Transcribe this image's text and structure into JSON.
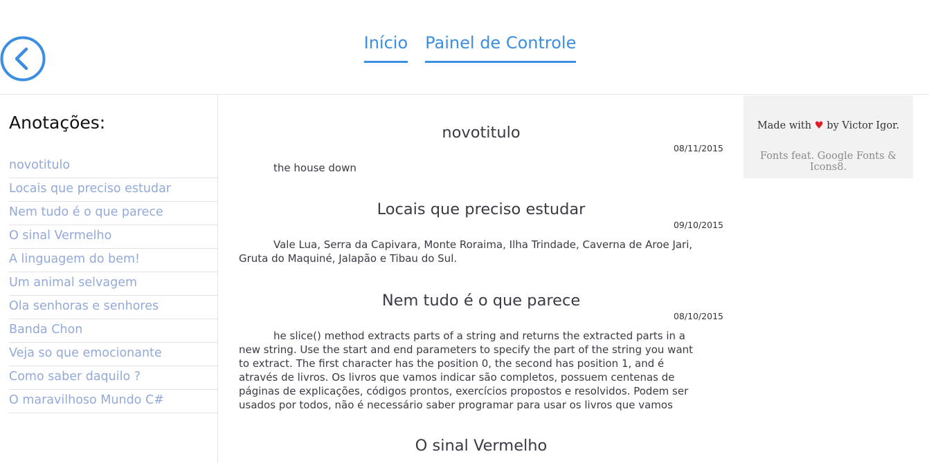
{
  "header": {
    "back_icon": "chevron-left-circle-icon",
    "accent_color": "#3b8ee0",
    "nav": [
      {
        "label": "Início"
      },
      {
        "label": "Painel de Controle"
      }
    ]
  },
  "sidebar": {
    "title": "Anotações:",
    "items": [
      {
        "label": "novotitulo"
      },
      {
        "label": "Locais que preciso estudar"
      },
      {
        "label": "Nem tudo é o que parece"
      },
      {
        "label": "O sinal Vermelho"
      },
      {
        "label": "A linguagem do bem!"
      },
      {
        "label": "Um animal selvagem"
      },
      {
        "label": "Ola senhoras e senhores"
      },
      {
        "label": "Banda Chon"
      },
      {
        "label": "Veja so que emocionante"
      },
      {
        "label": "Como saber daquilo ?"
      },
      {
        "label": "O maravilhoso Mundo C#"
      }
    ]
  },
  "notes": [
    {
      "title": "novotitulo",
      "date": "08/11/2015",
      "body": "the house down"
    },
    {
      "title": "Locais que preciso estudar",
      "date": "09/10/2015",
      "body": "Vale Lua, Serra da Capivara, Monte Roraima, Ilha Trindade, Caverna de Aroe Jari, Gruta do Maquiné, Jalapão e Tibau do Sul."
    },
    {
      "title": "Nem tudo é o que parece",
      "date": "08/10/2015",
      "body": "he slice() method extracts parts of a string and returns the extracted parts in a new string. Use the start and end parameters to specify the part of the string you want to extract. The first character has the position 0, the second has position 1, and é através de livros. Os livros que vamos indicar são completos, possuem centenas de páginas de explicações, códigos prontos, exercícios propostos e resolvidos. Podem ser usados por todos, não é necessário saber programar para usar os livros que vamos"
    },
    {
      "title": "O sinal Vermelho"
    }
  ],
  "credits": {
    "made_with": "Made with",
    "heart": "♥",
    "by": "by Victor Igor.",
    "fonts": "Fonts feat. Google Fonts & Icons8."
  }
}
